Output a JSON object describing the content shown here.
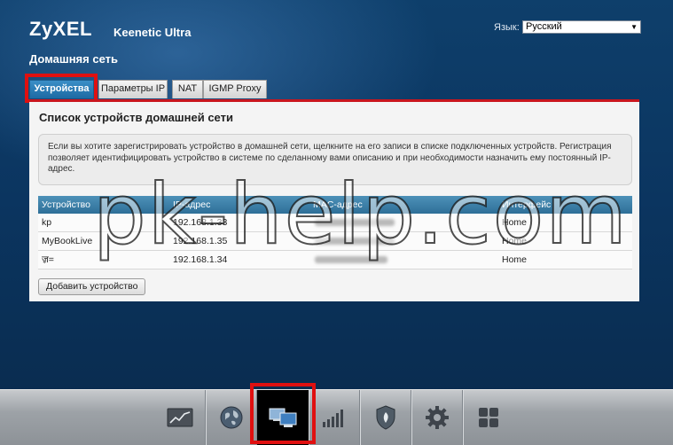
{
  "header": {
    "brand": "ZyXEL",
    "model": "Keenetic Ultra",
    "language_label": "Язык:",
    "language_value": "Русский"
  },
  "page_title": "Домашняя сеть",
  "tabs": [
    {
      "label": "Устройства",
      "active": true
    },
    {
      "label": "Параметры IP",
      "active": false
    },
    {
      "label": "NAT",
      "active": false
    },
    {
      "label": "IGMP Proxy",
      "active": false
    }
  ],
  "panel": {
    "title": "Список устройств домашней сети",
    "info_text": "Если вы хотите зарегистрировать устройство в домашней сети, щелкните на его записи в списке подключенных устройств. Регистрация позволяет идентифицировать устройство в системе по сделанному вами описанию и при необходимости назначить ему постоянный IP-адрес."
  },
  "table": {
    "columns": [
      "Устройство",
      "IP-адрес",
      "MAC-адрес",
      "Интерфейс"
    ],
    "rows": [
      {
        "device": "kp",
        "ip": "192.168.1.33",
        "interface": "Home"
      },
      {
        "device": "MyBookLive",
        "ip": "192.168.1.35",
        "interface": "Home"
      },
      {
        "device": "ॹ=",
        "ip": "192.168.1.34",
        "interface": "Home"
      }
    ]
  },
  "add_button": "Добавить устройство",
  "watermark": "pk-help.com",
  "colors": {
    "accent_red": "#c9161e",
    "tab_active": "#2577b4",
    "highlight": "#e01010"
  },
  "bottom_nav": [
    {
      "icon": "statistics-icon"
    },
    {
      "icon": "internet-globe-icon"
    },
    {
      "icon": "home-network-icon",
      "active": true
    },
    {
      "icon": "wifi-signal-icon"
    },
    {
      "icon": "security-shield-icon"
    },
    {
      "icon": "settings-gear-icon"
    },
    {
      "icon": "apps-grid-icon"
    }
  ]
}
